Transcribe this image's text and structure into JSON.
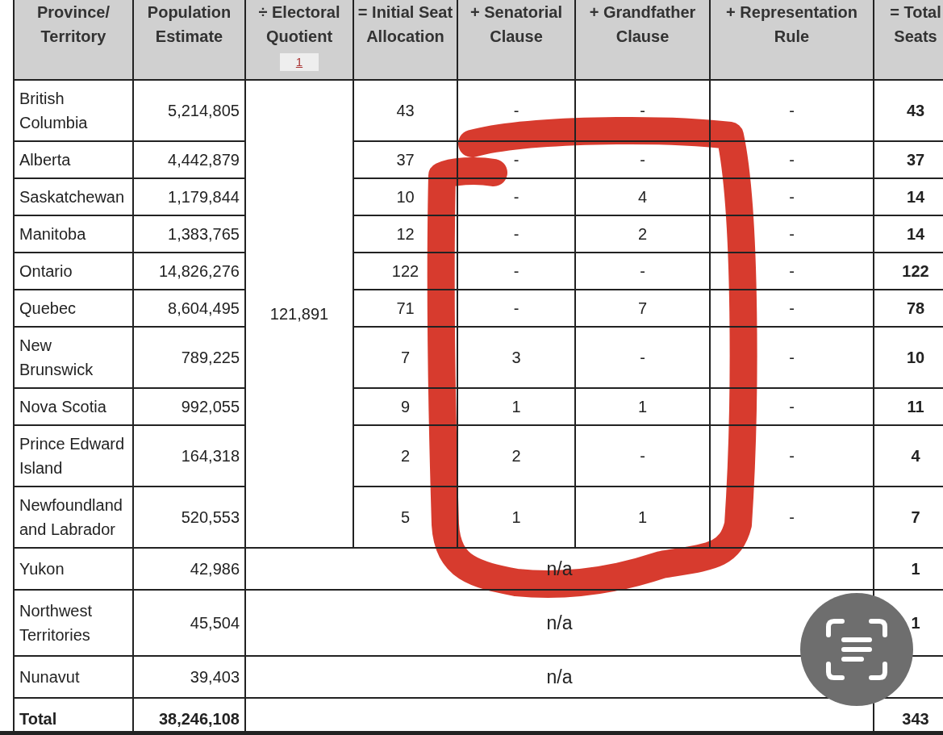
{
  "table": {
    "columns": [
      {
        "label": "Province/ Territory"
      },
      {
        "label": "Population Estimate"
      },
      {
        "label": "÷ Electoral Quotient",
        "footnote": "1"
      },
      {
        "label": "= Initial Seat Allocation"
      },
      {
        "label": "+ Senatorial Clause"
      },
      {
        "label": "+ Grandfather Clause"
      },
      {
        "label": "+ Representation Rule"
      },
      {
        "label": "= Total Seats"
      }
    ],
    "quotient": "121,891",
    "rows": [
      {
        "kind": "province",
        "name": "British Columbia",
        "population": "5,214,805",
        "initial": "43",
        "senatorial": "-",
        "grandfather": "-",
        "representation": "-",
        "total": "43"
      },
      {
        "kind": "province",
        "name": "Alberta",
        "population": "4,442,879",
        "initial": "37",
        "senatorial": "-",
        "grandfather": "-",
        "representation": "-",
        "total": "37"
      },
      {
        "kind": "province",
        "name": "Saskatchewan",
        "population": "1,179,844",
        "initial": "10",
        "senatorial": "-",
        "grandfather": "4",
        "representation": "-",
        "total": "14"
      },
      {
        "kind": "province",
        "name": "Manitoba",
        "population": "1,383,765",
        "initial": "12",
        "senatorial": "-",
        "grandfather": "2",
        "representation": "-",
        "total": "14"
      },
      {
        "kind": "province",
        "name": "Ontario",
        "population": "14,826,276",
        "initial": "122",
        "senatorial": "-",
        "grandfather": "-",
        "representation": "-",
        "total": "122"
      },
      {
        "kind": "province",
        "name": "Quebec",
        "population": "8,604,495",
        "initial": "71",
        "senatorial": "-",
        "grandfather": "7",
        "representation": "-",
        "total": "78"
      },
      {
        "kind": "province",
        "name": "New Brunswick",
        "population": "789,225",
        "initial": "7",
        "senatorial": "3",
        "grandfather": "-",
        "representation": "-",
        "total": "10"
      },
      {
        "kind": "province",
        "name": "Nova Scotia",
        "population": "992,055",
        "initial": "9",
        "senatorial": "1",
        "grandfather": "1",
        "representation": "-",
        "total": "11"
      },
      {
        "kind": "province",
        "name": "Prince Edward Island",
        "population": "164,318",
        "initial": "2",
        "senatorial": "2",
        "grandfather": "-",
        "representation": "-",
        "total": "4"
      },
      {
        "kind": "province",
        "name": "Newfoundland and Labrador",
        "population": "520,553",
        "initial": "5",
        "senatorial": "1",
        "grandfather": "1",
        "representation": "-",
        "total": "7"
      },
      {
        "kind": "territory",
        "name": "Yukon",
        "population": "42,986",
        "allocation": "n/a",
        "total": "1"
      },
      {
        "kind": "territory",
        "name": "Northwest Territories",
        "population": "45,504",
        "allocation": "n/a",
        "total": "1"
      },
      {
        "kind": "territory",
        "name": "Nunavut",
        "population": "39,403",
        "allocation": "n/a"
      },
      {
        "kind": "total",
        "name": "Total",
        "population": "38,246,108",
        "total": "343"
      }
    ]
  }
}
